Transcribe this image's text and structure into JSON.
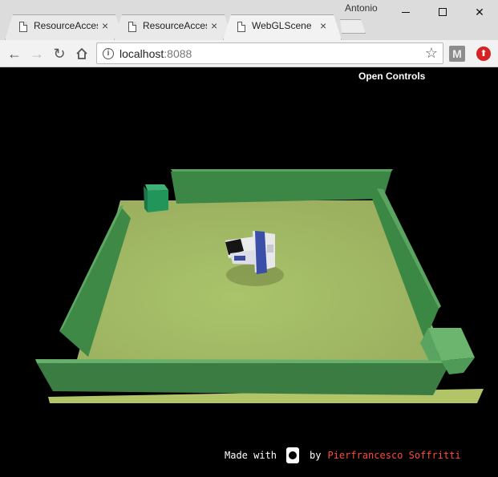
{
  "browser": {
    "profile_name": "Antonio",
    "tabs": [
      {
        "title": "ResourceAccess"
      },
      {
        "title": "ResourceAccess"
      },
      {
        "title": "WebGLScene"
      }
    ],
    "close_glyph": "×",
    "url_host": "localhost",
    "url_port": ":8088",
    "extension_m_label": "M"
  },
  "scene": {
    "open_controls_label": "Open Controls",
    "footer": {
      "made_with": "Made with",
      "by": "by",
      "author": "Pierfrancesco Soffritti"
    },
    "colors": {
      "background": "#000000",
      "floor": "#a6bb66",
      "wall": "#3d8a48",
      "cube": "#2a9e63",
      "author": "#ff4a3a"
    }
  }
}
